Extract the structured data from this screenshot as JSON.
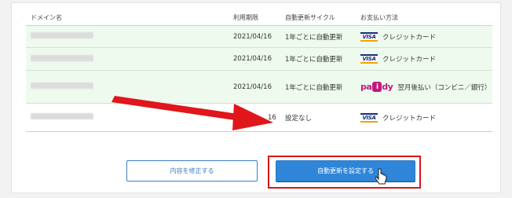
{
  "table": {
    "headers": {
      "domain": "ドメイン名",
      "expiry": "利用期限",
      "cycle": "自動更新サイクル",
      "payment": "お支払い方法"
    },
    "rows": [
      {
        "domain": "",
        "expiry": "2021/04/16",
        "cycle": "1年ごとに自動更新",
        "payment_method": "visa",
        "payment": "クレジットカード"
      },
      {
        "domain": "",
        "expiry": "2021/04/16",
        "cycle": "1年ごとに自動更新",
        "payment_method": "visa",
        "payment": "クレジットカード"
      },
      {
        "domain": "",
        "expiry": "2021/04/16",
        "cycle": "1年ごとに自動更新",
        "payment_method": "paidy",
        "payment": "翌月後払い（コンビニ／銀行）"
      },
      {
        "domain": "",
        "expiry": "16",
        "cycle": "設定なし",
        "payment_method": "visa",
        "payment": "クレジットカード"
      }
    ]
  },
  "logos": {
    "visa": "VISA",
    "paidy_prefix": "pa",
    "paidy_box": "i",
    "paidy_suffix": "dy"
  },
  "buttons": {
    "edit": "内容を修正する",
    "set_auto_renew": "自動更新を設定する"
  },
  "colors": {
    "row_highlight": "#eefaee",
    "primary": "#2f86d9",
    "annotation_red": "#d7161c"
  },
  "icons": [
    "visa-logo",
    "paidy-logo",
    "red-arrow-annotation",
    "mouse-pointer-icon"
  ]
}
